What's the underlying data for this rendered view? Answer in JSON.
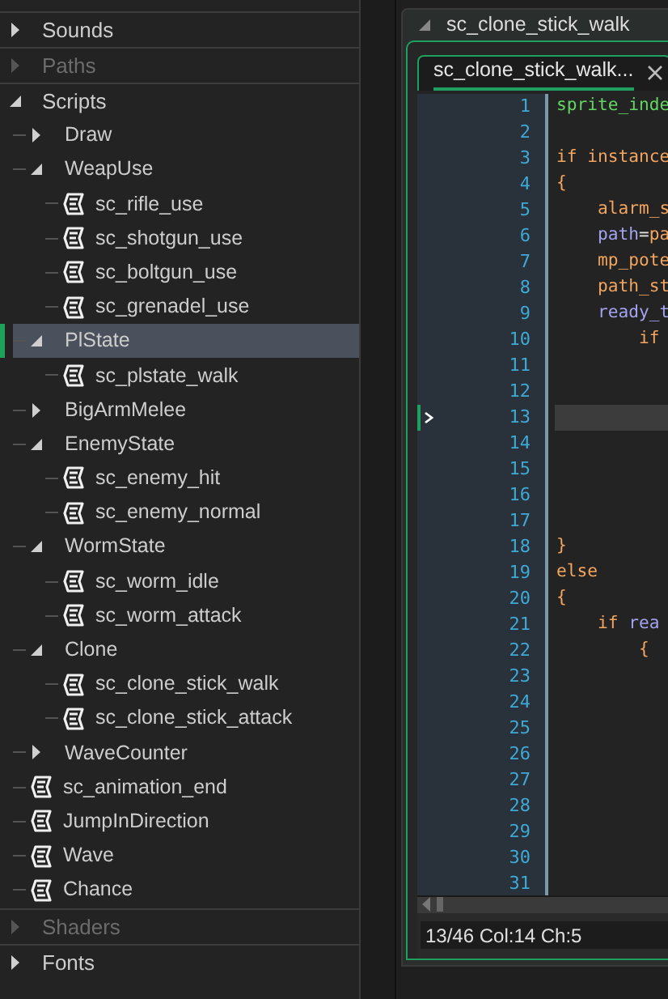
{
  "resource_tree": [
    {
      "label": "Sounds",
      "kind": "section",
      "expanded": false,
      "disabled": false
    },
    {
      "label": "Paths",
      "kind": "section",
      "expanded": false,
      "disabled": true
    },
    {
      "label": "Scripts",
      "kind": "section",
      "expanded": true,
      "disabled": false,
      "children": [
        {
          "label": "Draw",
          "kind": "folder",
          "expanded": false,
          "selected": false
        },
        {
          "label": "WeapUse",
          "kind": "folder",
          "expanded": true,
          "selected": false,
          "children": [
            {
              "label": "sc_rifle_use",
              "kind": "script",
              "selected": false
            },
            {
              "label": "sc_shotgun_use",
              "kind": "script",
              "selected": false
            },
            {
              "label": "sc_boltgun_use",
              "kind": "script",
              "selected": false
            },
            {
              "label": "sc_grenadel_use",
              "kind": "script",
              "selected": false
            }
          ]
        },
        {
          "label": "PlState",
          "kind": "folder",
          "expanded": true,
          "selected": true,
          "children": [
            {
              "label": "sc_plstate_walk",
              "kind": "script",
              "selected": false
            }
          ]
        },
        {
          "label": "BigArmMelee",
          "kind": "folder",
          "expanded": false,
          "selected": false
        },
        {
          "label": "EnemyState",
          "kind": "folder",
          "expanded": true,
          "selected": false,
          "children": [
            {
              "label": "sc_enemy_hit",
              "kind": "script",
              "selected": false
            },
            {
              "label": "sc_enemy_normal",
              "kind": "script",
              "selected": false
            }
          ]
        },
        {
          "label": "WormState",
          "kind": "folder",
          "expanded": true,
          "selected": false,
          "children": [
            {
              "label": "sc_worm_idle",
              "kind": "script",
              "selected": false
            },
            {
              "label": "sc_worm_attack",
              "kind": "script",
              "selected": false
            }
          ]
        },
        {
          "label": "Clone",
          "kind": "folder",
          "expanded": true,
          "selected": false,
          "children": [
            {
              "label": "sc_clone_stick_walk",
              "kind": "script",
              "selected": false
            },
            {
              "label": "sc_clone_stick_attack",
              "kind": "script",
              "selected": false
            }
          ]
        },
        {
          "label": "WaveCounter",
          "kind": "folder",
          "expanded": false,
          "selected": false
        },
        {
          "label": "sc_animation_end",
          "kind": "script",
          "selected": false
        },
        {
          "label": "JumpInDirection",
          "kind": "script",
          "selected": false
        },
        {
          "label": "Wave",
          "kind": "script",
          "selected": false
        },
        {
          "label": "Chance",
          "kind": "script",
          "selected": false
        }
      ]
    },
    {
      "label": "Shaders",
      "kind": "section",
      "expanded": false,
      "disabled": true
    },
    {
      "label": "Fonts",
      "kind": "section",
      "expanded": false,
      "disabled": false
    }
  ],
  "editor_window": {
    "title": "sc_clone_stick_walk",
    "tabs": [
      {
        "label": "sc_clone_stick_walk...",
        "selected": true
      }
    ],
    "lines": [
      {
        "number": "1",
        "selected": false,
        "tokens": [
          {
            "text": "sprite_inde",
            "kind": "builtin"
          }
        ]
      },
      {
        "number": "2",
        "selected": false
      },
      {
        "number": "3",
        "selected": false,
        "tokens": [
          {
            "text": "if instance",
            "kind": "keyword"
          }
        ]
      },
      {
        "number": "4",
        "selected": false,
        "tokens": [
          {
            "text": "{",
            "kind": "keyword"
          }
        ]
      },
      {
        "number": "5",
        "selected": false,
        "tokens": [
          {
            "text": "    alarm_s",
            "kind": "keyword"
          }
        ]
      },
      {
        "number": "6",
        "selected": false,
        "tokens": [
          {
            "text": "    path",
            "kind": "variable"
          },
          {
            "text": "=",
            "kind": "plain"
          },
          {
            "text": "pa",
            "kind": "keyword"
          }
        ]
      },
      {
        "number": "7",
        "selected": false,
        "tokens": [
          {
            "text": "    mp_pote",
            "kind": "keyword"
          }
        ]
      },
      {
        "number": "8",
        "selected": false,
        "tokens": [
          {
            "text": "    path_st",
            "kind": "keyword"
          }
        ]
      },
      {
        "number": "9",
        "selected": false,
        "tokens": [
          {
            "text": "    ready_t",
            "kind": "variable"
          }
        ]
      },
      {
        "number": "10",
        "selected": false,
        "tokens": [
          {
            "text": "        if",
            "kind": "keyword"
          }
        ]
      },
      {
        "number": "11",
        "selected": false
      },
      {
        "number": "12",
        "selected": false
      },
      {
        "number": "13",
        "selected": true
      },
      {
        "number": "14",
        "selected": false
      },
      {
        "number": "15",
        "selected": false
      },
      {
        "number": "16",
        "selected": false
      },
      {
        "number": "17",
        "selected": false
      },
      {
        "number": "18",
        "selected": false,
        "tokens": [
          {
            "text": "}",
            "kind": "keyword"
          }
        ]
      },
      {
        "number": "19",
        "selected": false,
        "tokens": [
          {
            "text": "else",
            "kind": "keyword"
          }
        ]
      },
      {
        "number": "20",
        "selected": false,
        "tokens": [
          {
            "text": "{",
            "kind": "keyword"
          }
        ]
      },
      {
        "number": "21",
        "selected": false,
        "tokens": [
          {
            "text": "    if ",
            "kind": "keyword"
          },
          {
            "text": "rea",
            "kind": "variable"
          }
        ]
      },
      {
        "number": "22",
        "selected": false,
        "tokens": [
          {
            "text": "        {",
            "kind": "keyword"
          }
        ]
      },
      {
        "number": "23",
        "selected": false
      },
      {
        "number": "24",
        "selected": false
      },
      {
        "number": "25",
        "selected": false
      },
      {
        "number": "26",
        "selected": false
      },
      {
        "number": "27",
        "selected": false
      },
      {
        "number": "28",
        "selected": false
      },
      {
        "number": "29",
        "selected": false
      },
      {
        "number": "30",
        "selected": false
      },
      {
        "number": "31",
        "selected": false
      }
    ],
    "status": "13/46 Col:14 Ch:5"
  }
}
